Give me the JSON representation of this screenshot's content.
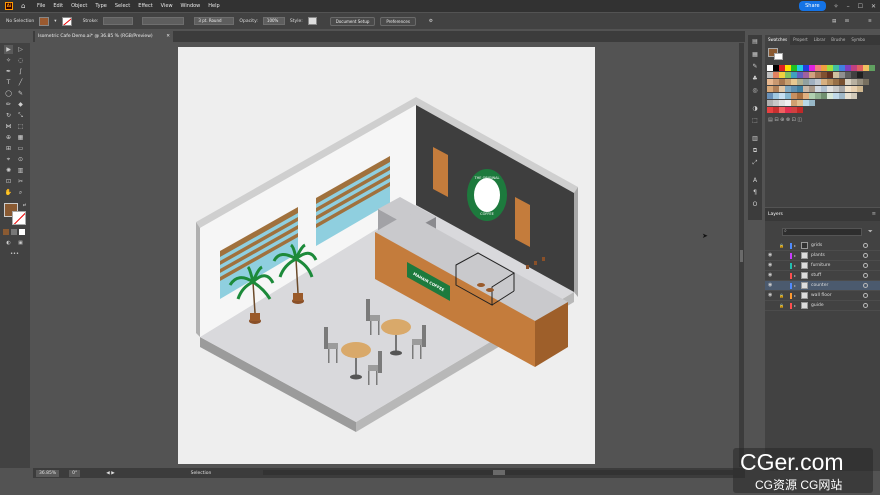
{
  "menubar": {
    "logo": "Ai",
    "items": [
      "File",
      "Edit",
      "Object",
      "Type",
      "Select",
      "Effect",
      "View",
      "Window",
      "Help"
    ],
    "share_label": "Share"
  },
  "controlbar": {
    "selection_label": "No Selection",
    "stroke_label": "Stroke:",
    "brush_label": "3 pt. Round",
    "opacity_label": "Opacity:",
    "opacity_value": "100%",
    "style_label": "Style:",
    "document_setup": "Document Setup",
    "preferences": "Preferences"
  },
  "document": {
    "tab_title": "Isometric Cafe Demo.ai* @ 36.85 % (RGB/Preview)",
    "zoom": "36.85%",
    "rotation": "0°",
    "tool_status": "Selection"
  },
  "artwork": {
    "sign_text": "MAHAIR COFFEE",
    "logo_text_top": "THE ORIGINAL",
    "logo_text_bottom": "COFFEE",
    "colors": {
      "wall_dark": "#3e3e3e",
      "floor": "#d9d9dc",
      "counter": "#c47c3c",
      "green": "#1d7a3d",
      "window": "#8fcfdf",
      "palm": "#1c8a3a",
      "blinds": "#a0713d"
    }
  },
  "swatches_panel": {
    "tabs": [
      "Swatches",
      "Propert",
      "Librar",
      "Brushe",
      "Symbo"
    ],
    "active_tab": "Swatches"
  },
  "layers_panel": {
    "title": "Layers",
    "layers": [
      {
        "name": "grids",
        "color": "#4f8bff",
        "locked": true,
        "visible": false
      },
      {
        "name": "plants",
        "color": "#c83cff",
        "locked": false,
        "visible": true
      },
      {
        "name": "furniture",
        "color": "#20c0b0",
        "locked": false,
        "visible": true
      },
      {
        "name": "stuff",
        "color": "#ff4f4f",
        "locked": false,
        "visible": true
      },
      {
        "name": "counter",
        "color": "#4f8bff",
        "locked": false,
        "visible": true,
        "selected": true
      },
      {
        "name": "wall floor",
        "color": "#ff9a30",
        "locked": true,
        "visible": true
      },
      {
        "name": "guide",
        "color": "#ff4f4f",
        "locked": true,
        "visible": false
      }
    ]
  },
  "watermark": {
    "main": "CGer.com",
    "sub": "CG资源 CG网站"
  }
}
